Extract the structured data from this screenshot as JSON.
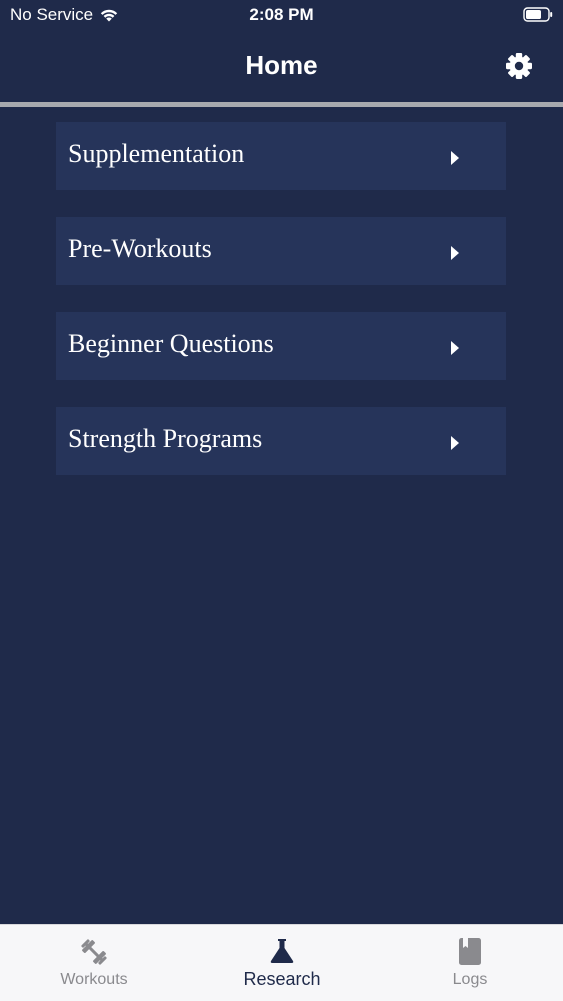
{
  "status_bar": {
    "carrier": "No Service",
    "time": "2:08 PM",
    "wifi_icon": "wifi-icon",
    "battery_icon": "battery-icon"
  },
  "nav": {
    "title": "Home",
    "settings_icon": "gear-icon"
  },
  "menu": {
    "items": [
      {
        "label": "Supplementation",
        "icon": "chevron-right-icon"
      },
      {
        "label": "Pre-Workouts",
        "icon": "chevron-right-icon"
      },
      {
        "label": "Beginner Questions",
        "icon": "chevron-right-icon"
      },
      {
        "label": "Strength Programs",
        "icon": "chevron-right-icon"
      }
    ]
  },
  "tab_bar": {
    "tabs": [
      {
        "label": "Workouts",
        "icon": "dumbbell-icon",
        "selected": false
      },
      {
        "label": "Research",
        "icon": "flask-icon",
        "selected": true
      },
      {
        "label": "Logs",
        "icon": "book-icon",
        "selected": false
      }
    ]
  },
  "colors": {
    "background": "#1f2a4a",
    "card": "#26345a",
    "tab_bar": "#f7f7f9",
    "active_tab": "#1f2a4a",
    "inactive_tab": "#8a8a8e"
  }
}
